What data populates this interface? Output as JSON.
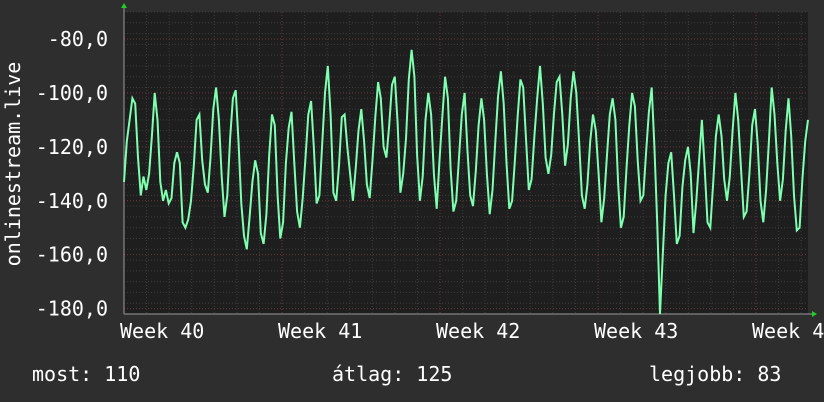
{
  "chart_data": {
    "type": "line",
    "ylabel": "onlinestream.live",
    "ylim": [
      -182,
      -70
    ],
    "yticks": [
      -80,
      -100,
      -120,
      -140,
      -160,
      -180
    ],
    "ytick_labels": [
      "-80,0",
      "-100,0",
      "-120,0",
      "-140,0",
      "-160,0",
      "-180,0"
    ],
    "xlim": [
      0,
      100
    ],
    "xticks": [
      {
        "x": 0,
        "label": "Week 40"
      },
      {
        "x": 23.1,
        "label": "Week 41"
      },
      {
        "x": 46.2,
        "label": "Week 42"
      },
      {
        "x": 69.3,
        "label": "Week 43"
      },
      {
        "x": 92.4,
        "label": "Week 4"
      }
    ],
    "grid": true,
    "colors": {
      "line": "#7fffb0",
      "plot_bg": "#1e1e1e",
      "grid_minor": "#3c3c3c",
      "grid_major": "#6a3838",
      "axis_arrow": "#22cc22"
    },
    "series": [
      {
        "values": [
          -133,
          -118,
          -110,
          -102,
          -104,
          -124,
          -138,
          -131,
          -136,
          -130,
          -116,
          -100,
          -110,
          -133,
          -140,
          -136,
          -141,
          -139,
          -126,
          -122,
          -126,
          -148,
          -150,
          -147,
          -140,
          -127,
          -110,
          -108,
          -125,
          -134,
          -137,
          -124,
          -106,
          -98,
          -110,
          -131,
          -146,
          -138,
          -117,
          -102,
          -99,
          -118,
          -141,
          -153,
          -158,
          -146,
          -133,
          -125,
          -130,
          -152,
          -156,
          -145,
          -123,
          -108,
          -112,
          -138,
          -154,
          -148,
          -126,
          -113,
          -107,
          -126,
          -144,
          -150,
          -139,
          -124,
          -108,
          -103,
          -120,
          -141,
          -138,
          -119,
          -100,
          -90,
          -108,
          -137,
          -140,
          -127,
          -109,
          -108,
          -120,
          -130,
          -140,
          -128,
          -114,
          -106,
          -118,
          -134,
          -139,
          -125,
          -109,
          -96,
          -102,
          -120,
          -124,
          -112,
          -97,
          -94,
          -111,
          -137,
          -130,
          -117,
          -95,
          -84,
          -94,
          -123,
          -140,
          -131,
          -110,
          -100,
          -108,
          -130,
          -143,
          -125,
          -109,
          -94,
          -102,
          -128,
          -144,
          -140,
          -124,
          -108,
          -100,
          -121,
          -138,
          -142,
          -129,
          -112,
          -102,
          -110,
          -130,
          -145,
          -136,
          -118,
          -101,
          -92,
          -104,
          -126,
          -143,
          -140,
          -125,
          -109,
          -95,
          -98,
          -117,
          -136,
          -132,
          -116,
          -102,
          -90,
          -104,
          -124,
          -130,
          -123,
          -108,
          -96,
          -94,
          -108,
          -127,
          -119,
          -102,
          -92,
          -100,
          -118,
          -138,
          -143,
          -134,
          -118,
          -108,
          -114,
          -130,
          -148,
          -139,
          -123,
          -108,
          -102,
          -110,
          -134,
          -150,
          -146,
          -128,
          -112,
          -100,
          -105,
          -125,
          -140,
          -138,
          -122,
          -107,
          -98,
          -120,
          -148,
          -182,
          -160,
          -138,
          -126,
          -122,
          -138,
          -156,
          -153,
          -135,
          -125,
          -120,
          -130,
          -152,
          -140,
          -125,
          -110,
          -128,
          -148,
          -150,
          -134,
          -116,
          -108,
          -116,
          -132,
          -140,
          -131,
          -114,
          -100,
          -110,
          -128,
          -146,
          -144,
          -130,
          -112,
          -106,
          -119,
          -140,
          -148,
          -136,
          -118,
          -98,
          -108,
          -126,
          -140,
          -132,
          -114,
          -102,
          -116,
          -138,
          -151,
          -150,
          -132,
          -118,
          -110
        ]
      }
    ]
  },
  "footer": {
    "now": "most: 110",
    "avg": "átlag: 125",
    "best": "legjobb: 83"
  }
}
